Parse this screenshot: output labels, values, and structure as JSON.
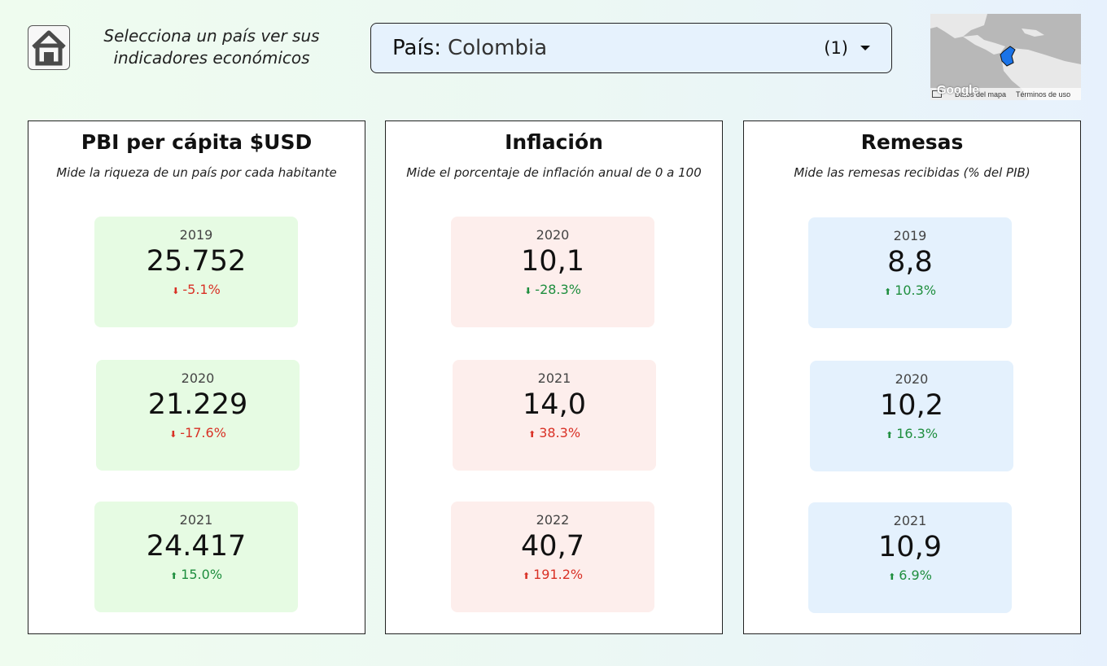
{
  "header": {
    "prompt": "Selecciona un país ver sus indicadores económicos",
    "country_label": "País:",
    "country_value": "Colombia",
    "selected_count": "(1)"
  },
  "map": {
    "footer_logo": "Google",
    "map_data_link": "Datos del mapa",
    "terms_link": "Términos de uso"
  },
  "panels": [
    {
      "title": "PBI per cápita $USD",
      "subtitle": "Mide la riqueza de un país por cada habitante",
      "cards": [
        {
          "year": "2019",
          "value": "25.752",
          "delta": "-5.1%",
          "arrow": "⬇"
        },
        {
          "year": "2020",
          "value": "21.229",
          "delta": "-17.6%",
          "arrow": "⬇"
        },
        {
          "year": "2021",
          "value": "24.417",
          "delta": "15.0%",
          "arrow": "⬆"
        }
      ]
    },
    {
      "title": "Inflación",
      "subtitle": "Mide el porcentaje de inflación anual de 0 a 100",
      "cards": [
        {
          "year": "2020",
          "value": "10,1",
          "delta": "-28.3%",
          "arrow": "⬇"
        },
        {
          "year": "2021",
          "value": "14,0",
          "delta": "38.3%",
          "arrow": "⬆"
        },
        {
          "year": "2022",
          "value": "40,7",
          "delta": "191.2%",
          "arrow": "⬆"
        }
      ]
    },
    {
      "title": "Remesas",
      "subtitle": "Mide las remesas recibidas (% del PIB)",
      "cards": [
        {
          "year": "2019",
          "value": "8,8",
          "delta": "10.3%",
          "arrow": "⬆"
        },
        {
          "year": "2020",
          "value": "10,2",
          "delta": "16.3%",
          "arrow": "⬆"
        },
        {
          "year": "2021",
          "value": "10,9",
          "delta": "6.9%",
          "arrow": "⬆"
        }
      ]
    }
  ],
  "colors": {
    "negative": "#d93025",
    "positive": "#1e8e3e",
    "pbi_card_bg": "#e6fbe3",
    "inflation_card_bg": "#fdeeec",
    "remittance_card_bg": "#e4f1fd",
    "selected_country_fill": "#1a73e8"
  }
}
